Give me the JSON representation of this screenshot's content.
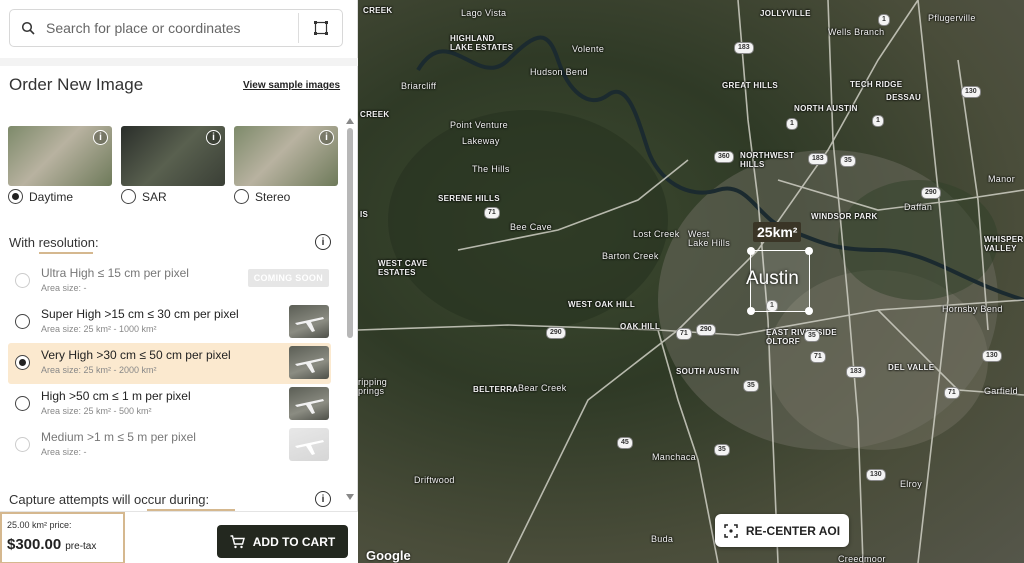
{
  "search": {
    "placeholder": "Search for place or coordinates"
  },
  "panel": {
    "title": "Order New Image",
    "sample_link": "View sample images",
    "image_types": [
      {
        "label": "Daytime",
        "selected": true
      },
      {
        "label": "SAR",
        "selected": false
      },
      {
        "label": "Stereo",
        "selected": false
      }
    ],
    "resolution_heading": "With resolution:",
    "resolutions": [
      {
        "name": "Ultra High ≤ 15 cm per pixel",
        "area": "Area size: -",
        "badge": "COMING SOON"
      },
      {
        "name": "Super High >15 cm ≤ 30 cm per pixel",
        "area": "Area size: 25 km² - 1000 km²"
      },
      {
        "name": "Very High >30 cm ≤ 50 cm per pixel",
        "area": "Area size: 25 km² - 2000 km²"
      },
      {
        "name": "High >50 cm ≤ 1 m per pixel",
        "area": "Area size: 25 km² - 500 km²"
      },
      {
        "name": "Medium >1 m ≤ 5 m per pixel",
        "area": "Area size: -"
      }
    ],
    "capture_heading": "Capture attempts will occur during:"
  },
  "footer": {
    "price_label": "25.00 km² price:",
    "price": "$300.00",
    "price_note": "pre-tax",
    "add_to_cart": "ADD TO CART"
  },
  "map": {
    "aoi_area": "25km²",
    "aoi_city": "Austin",
    "recenter": "RE-CENTER AOI",
    "attribution": "Google",
    "labels": {
      "l1": "Lago Vista",
      "l2": "Jollyville",
      "l3": "Pflugerville",
      "l4": "Wells Branch",
      "l5": "HIGHLAND\nLAKE ESTATES",
      "l6": "Volente",
      "l7": "Hudson Bend",
      "l8": "Briarcliff",
      "l9": "GREAT HILLS",
      "l10": "TECH RIDGE",
      "l11": "DESSAU",
      "l12": "NORTH AUSTIN",
      "l13": "Point Venture",
      "l14": "Lakeway",
      "l15": "CREEK",
      "l16": "NORTHWEST\nHILLS",
      "l17": "The Hills",
      "l18": "SERENE HILLS",
      "l19": "Manor",
      "l20": "Daffan",
      "l21": "Bee Cave",
      "l22": "Lost Creek",
      "l23": "West\nLake Hills",
      "l24": "WINDSOR PARK",
      "l25": "WHISPER\nVALLEY",
      "l26": "WEST CAVE\nESTATES",
      "l27": "Barton Creek",
      "l28": "WEST OAK HILL",
      "l29": "OAK HILL",
      "l30": "EAST RIVERSIDE\nOLTORF",
      "l31": "Hornsby Bend",
      "l32": "SOUTH AUSTIN",
      "l33": "DEL VALLE",
      "l34": "BELTERRA",
      "l35": "Bear Creek",
      "l36": "ripping\nprings",
      "l37": "Garfield",
      "l38": "Driftwood",
      "l39": "Manchaca",
      "l40": "Elroy",
      "l41": "Buda",
      "l42": "Creedmoor",
      "l43": "CREEK",
      "l44": "IS"
    },
    "shields": [
      "183",
      "1",
      "130",
      "1",
      "360",
      "183",
      "35",
      "290",
      "71",
      "290",
      "71",
      "1",
      "290",
      "35",
      "71",
      "130",
      "183",
      "71",
      "35",
      "45",
      "35",
      "130",
      "1"
    ]
  }
}
